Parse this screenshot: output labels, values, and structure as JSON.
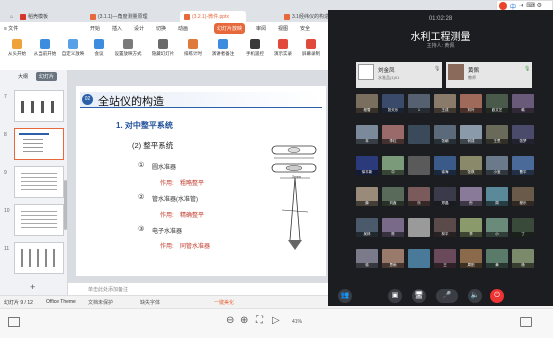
{
  "browser": {
    "tabs": [
      {
        "label": "稻壳模板",
        "color": "#d4372a"
      },
      {
        "label": "(3.1.1)—角度测量原理",
        "color": "#e7683a"
      },
      {
        "label": "(3.2.1)-微件.pptx",
        "color": "#e7683a"
      },
      {
        "label": "3.1经纬仪的构造",
        "color": "#e7683a"
      }
    ],
    "new_tab": "+"
  },
  "sogou": {
    "label": "中"
  },
  "menu": {
    "file": "≡ 文件",
    "items": [
      "开始",
      "插入",
      "设计",
      "切换",
      "动画",
      "幻灯片放映",
      "审阅",
      "视图",
      "安全"
    ],
    "active": "幻灯片放映"
  },
  "ribbon": [
    {
      "label": "从头开始",
      "color": "#f0a23a"
    },
    {
      "label": "从当前开始",
      "color": "#3c8de0"
    },
    {
      "label": "自定义放映",
      "color": "#5aa0e8"
    },
    {
      "label": "会议",
      "color": "#3c8de0"
    },
    {
      "label": "设置放映方式",
      "color": "#7a7a7a"
    },
    {
      "label": "隐藏幻灯片",
      "color": "#6a6a6a"
    },
    {
      "label": "排练计时",
      "color": "#e07a3a"
    },
    {
      "label": "演讲者备注",
      "color": "#3c8de0"
    },
    {
      "label": "手机遥控",
      "color": "#3a3a3a"
    },
    {
      "label": "演示实录",
      "color": "#e14a3a"
    },
    {
      "label": "屏幕录制",
      "color": "#e14a3a"
    }
  ],
  "outline": {
    "tab1": "大纲",
    "tab2": "幻灯片"
  },
  "thumbnails": [
    {
      "num": "7"
    },
    {
      "num": "8"
    },
    {
      "num": "9"
    },
    {
      "num": "10"
    },
    {
      "num": "11"
    }
  ],
  "slide": {
    "badge": "02",
    "title": "全站仪的构造",
    "heading": "1. 对中整平系统",
    "sub": "(2) 整平系统",
    "items": [
      {
        "no": "①",
        "name": "圆水准器",
        "role_label": "作用:",
        "role": "粗略整平"
      },
      {
        "no": "②",
        "name": "管水准器(水准管)",
        "role_label": "作用:",
        "role": "精确整平"
      },
      {
        "no": "③",
        "name": "电子水准器",
        "role_label": "作用:",
        "role": "同管水准器"
      }
    ],
    "figure_label": "2mm"
  },
  "notes": {
    "placeholder": "单击此处添加备注"
  },
  "status": {
    "slide_count": "幻灯片 9 / 12",
    "theme": "Office Theme",
    "protect": "文档未保护",
    "font": "缺失字体",
    "beautify": "一键美化"
  },
  "bottom": {
    "zoom": "41%"
  },
  "live": {
    "time": "01:02:28",
    "title": "水利工程测量",
    "subtitle": "主持人:  黄佩",
    "hosts": [
      {
        "name": "刘金凤",
        "role": "水准品(1)01"
      },
      {
        "name": "黄佩",
        "role": "教师"
      }
    ],
    "participants": [
      {
        "name": "程雪",
        "color": "#7a6e5e"
      },
      {
        "name": "张天乐",
        "color": "#3a4a6a"
      },
      {
        "name": "1",
        "color": "#556070"
      },
      {
        "name": "王成",
        "color": "#8a7a6a"
      },
      {
        "name": "刘叶",
        "color": "#a06a5a"
      },
      {
        "name": "欧文艺",
        "color": "#4a5a4a"
      },
      {
        "name": "韩",
        "color": "#6a5a7a"
      },
      {
        "name": "本",
        "color": "#7a8a9a"
      },
      {
        "name": "李红",
        "color": "#9a6a6a"
      },
      {
        "name": "",
        "color": "#3a4a5a"
      },
      {
        "name": "张朝",
        "color": "#5a6a7a"
      },
      {
        "name": "何成",
        "color": "#8a9aaa"
      },
      {
        "name": "王思",
        "color": "#6a6a5a"
      },
      {
        "name": "张梦",
        "color": "#4a4a6a"
      },
      {
        "name": "徐平新",
        "color": "#2a3a7a"
      },
      {
        "name": "中",
        "color": "#7a9a7a"
      },
      {
        "name": "",
        "color": "#5a5a5a"
      },
      {
        "name": "徐海",
        "color": "#3a5a8a"
      },
      {
        "name": "张祺",
        "color": "#8a8a6a"
      },
      {
        "name": "小宝",
        "color": "#6a7a8a"
      },
      {
        "name": "曹平",
        "color": "#4a6a9a"
      },
      {
        "name": "薛",
        "color": "#9a8a7a"
      },
      {
        "name": "刘鑫",
        "color": "#5a6a5a"
      },
      {
        "name": "乐",
        "color": "#7a5a5a"
      },
      {
        "name": "郑晶",
        "color": "#3a3a4a"
      },
      {
        "name": "彤",
        "color": "#8a7a9a"
      },
      {
        "name": "周",
        "color": "#5a8a9a"
      },
      {
        "name": "程乐",
        "color": "#6a5a4a"
      },
      {
        "name": "吴林",
        "color": "#4a5a6a"
      },
      {
        "name": "陈",
        "color": "#7a6a8a"
      },
      {
        "name": "",
        "color": "#9a9a9a"
      },
      {
        "name": "林平",
        "color": "#5a4a4a"
      },
      {
        "name": "李",
        "color": "#8a9a6a"
      },
      {
        "name": "小",
        "color": "#6a8a7a"
      },
      {
        "name": "丁",
        "color": "#3a4a3a"
      },
      {
        "name": "徐",
        "color": "#7a7a8a"
      },
      {
        "name": "思雨",
        "color": "#9a7a6a"
      },
      {
        "name": "",
        "color": "#4a7a9a"
      },
      {
        "name": "王",
        "color": "#6a4a5a"
      },
      {
        "name": "周阳",
        "color": "#8a6a4a"
      },
      {
        "name": "黄",
        "color": "#5a7a6a"
      },
      {
        "name": "杨",
        "color": "#7a8a6a"
      }
    ],
    "controls": [
      "👥",
      "▣",
      "🖥",
      "🎤",
      "🔈",
      "⏻"
    ]
  }
}
